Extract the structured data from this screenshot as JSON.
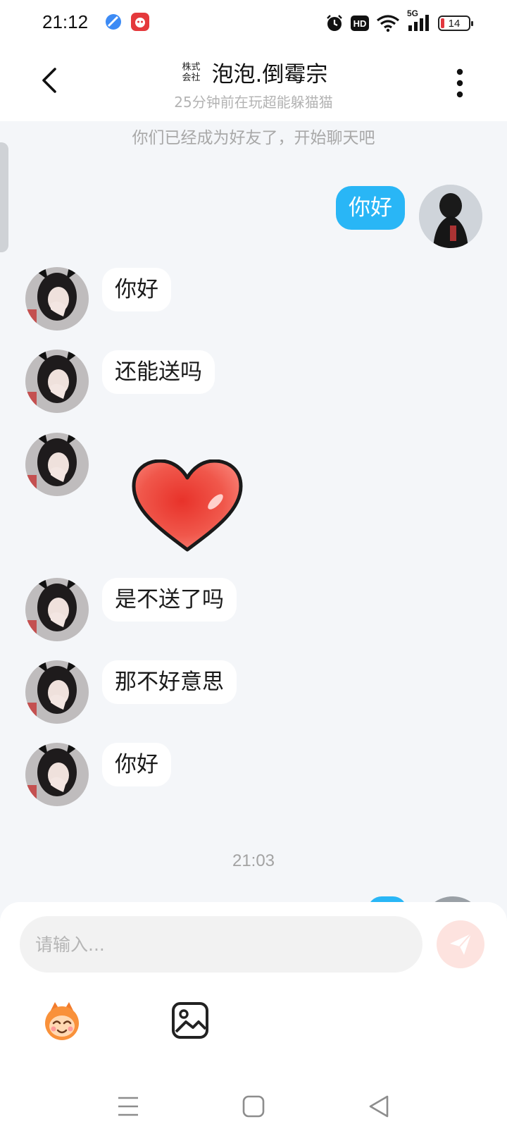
{
  "status_bar": {
    "time": "21:12",
    "network": "5G",
    "hd": "HD",
    "battery": "14"
  },
  "header": {
    "title_badge": "株式\n会社",
    "title": "泡泡.倒霉宗",
    "subtitle": "25分钟前在玩超能躲猫猫"
  },
  "conversation": {
    "system_message": "你们已经成为好友了，开始聊天吧",
    "messages": [
      {
        "from": "me",
        "text": "你好"
      },
      {
        "from": "them",
        "text": "你好"
      },
      {
        "from": "them",
        "text": "还能送吗"
      },
      {
        "from": "them",
        "sticker": "heart-sticker"
      },
      {
        "from": "them",
        "text": "是不送了吗"
      },
      {
        "from": "them",
        "text": "那不好意思"
      },
      {
        "from": "them",
        "text": "你好"
      }
    ],
    "timestamp": "21:03"
  },
  "composer": {
    "placeholder": "请输入..."
  },
  "colors": {
    "accent_blue": "#29b6f6",
    "send_button_disabled": "#fde3df",
    "background": "#f4f6f9"
  }
}
